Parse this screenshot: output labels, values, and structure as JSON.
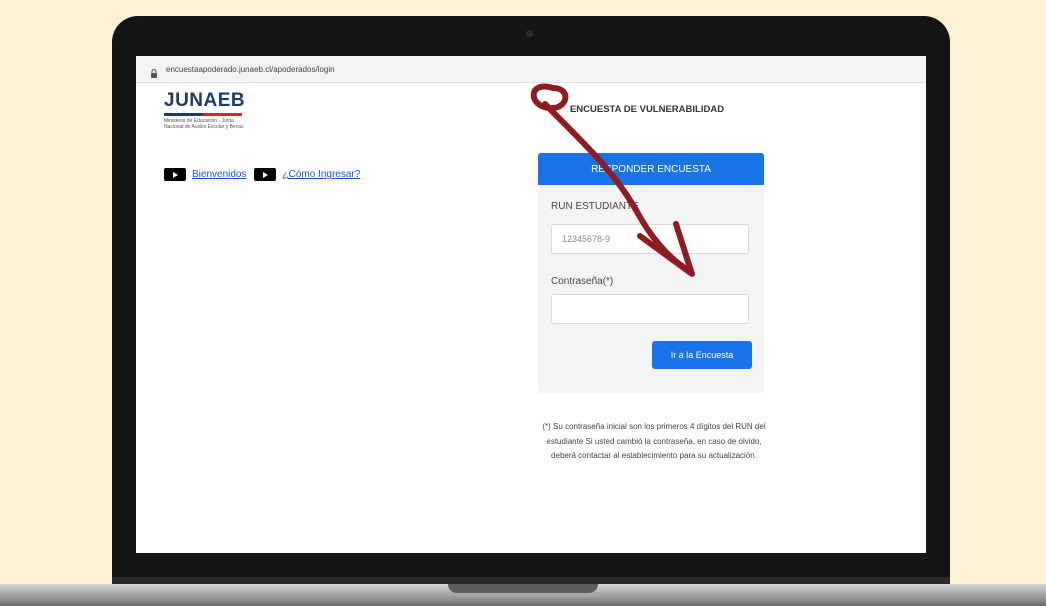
{
  "browser": {
    "url": "encuestaapoderado.junaeb.cl/apoderados/login"
  },
  "logo": {
    "text": "JUNAEB",
    "subtitle": "Ministerio de Educación · Junta Nacional de Auxilio Escolar y Becas",
    "stripe_colors": [
      "#1e3a6e",
      "#d52b1e"
    ]
  },
  "links": [
    {
      "label": "Bienvenidos",
      "icon": "play-icon"
    },
    {
      "label": "¿Cómo Ingresar?",
      "icon": "play-icon"
    }
  ],
  "survey": {
    "title": "ENCUESTA DE VULNERABILIDAD",
    "header": "RESPONDER ENCUESTA",
    "run_label": "RUN ESTUDIANTE",
    "run_value": "12345678-9",
    "password_label": "Contraseña(*)",
    "password_value": "",
    "submit_label": "Ir a la Encuesta",
    "footnote": "(*) Su contraseña inicial son los primeros 4 dígitos del RUN del estudiante Si usted cambió la contraseña, en caso de olvido, deberá contactar al establecimiento para su actualización."
  },
  "colors": {
    "accent": "#1a73e8",
    "annotation": "#8e1d23",
    "background": "#fdf0d5"
  },
  "annotation": {
    "icon": "hand-drawn-arrow-icon"
  }
}
